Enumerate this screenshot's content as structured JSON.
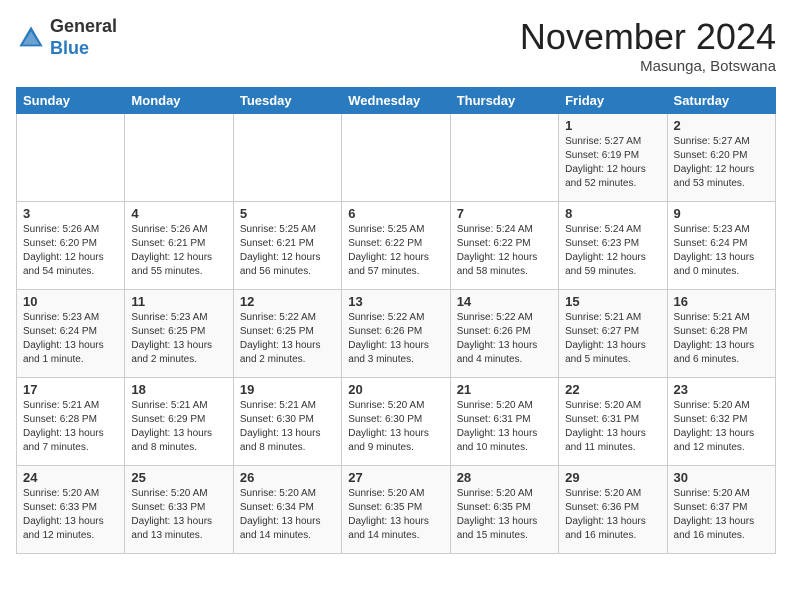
{
  "header": {
    "logo_line1": "General",
    "logo_line2": "Blue",
    "month": "November 2024",
    "location": "Masunga, Botswana"
  },
  "days_of_week": [
    "Sunday",
    "Monday",
    "Tuesday",
    "Wednesday",
    "Thursday",
    "Friday",
    "Saturday"
  ],
  "weeks": [
    [
      {
        "day": "",
        "info": ""
      },
      {
        "day": "",
        "info": ""
      },
      {
        "day": "",
        "info": ""
      },
      {
        "day": "",
        "info": ""
      },
      {
        "day": "",
        "info": ""
      },
      {
        "day": "1",
        "info": "Sunrise: 5:27 AM\nSunset: 6:19 PM\nDaylight: 12 hours\nand 52 minutes."
      },
      {
        "day": "2",
        "info": "Sunrise: 5:27 AM\nSunset: 6:20 PM\nDaylight: 12 hours\nand 53 minutes."
      }
    ],
    [
      {
        "day": "3",
        "info": "Sunrise: 5:26 AM\nSunset: 6:20 PM\nDaylight: 12 hours\nand 54 minutes."
      },
      {
        "day": "4",
        "info": "Sunrise: 5:26 AM\nSunset: 6:21 PM\nDaylight: 12 hours\nand 55 minutes."
      },
      {
        "day": "5",
        "info": "Sunrise: 5:25 AM\nSunset: 6:21 PM\nDaylight: 12 hours\nand 56 minutes."
      },
      {
        "day": "6",
        "info": "Sunrise: 5:25 AM\nSunset: 6:22 PM\nDaylight: 12 hours\nand 57 minutes."
      },
      {
        "day": "7",
        "info": "Sunrise: 5:24 AM\nSunset: 6:22 PM\nDaylight: 12 hours\nand 58 minutes."
      },
      {
        "day": "8",
        "info": "Sunrise: 5:24 AM\nSunset: 6:23 PM\nDaylight: 12 hours\nand 59 minutes."
      },
      {
        "day": "9",
        "info": "Sunrise: 5:23 AM\nSunset: 6:24 PM\nDaylight: 13 hours\nand 0 minutes."
      }
    ],
    [
      {
        "day": "10",
        "info": "Sunrise: 5:23 AM\nSunset: 6:24 PM\nDaylight: 13 hours\nand 1 minute."
      },
      {
        "day": "11",
        "info": "Sunrise: 5:23 AM\nSunset: 6:25 PM\nDaylight: 13 hours\nand 2 minutes."
      },
      {
        "day": "12",
        "info": "Sunrise: 5:22 AM\nSunset: 6:25 PM\nDaylight: 13 hours\nand 2 minutes."
      },
      {
        "day": "13",
        "info": "Sunrise: 5:22 AM\nSunset: 6:26 PM\nDaylight: 13 hours\nand 3 minutes."
      },
      {
        "day": "14",
        "info": "Sunrise: 5:22 AM\nSunset: 6:26 PM\nDaylight: 13 hours\nand 4 minutes."
      },
      {
        "day": "15",
        "info": "Sunrise: 5:21 AM\nSunset: 6:27 PM\nDaylight: 13 hours\nand 5 minutes."
      },
      {
        "day": "16",
        "info": "Sunrise: 5:21 AM\nSunset: 6:28 PM\nDaylight: 13 hours\nand 6 minutes."
      }
    ],
    [
      {
        "day": "17",
        "info": "Sunrise: 5:21 AM\nSunset: 6:28 PM\nDaylight: 13 hours\nand 7 minutes."
      },
      {
        "day": "18",
        "info": "Sunrise: 5:21 AM\nSunset: 6:29 PM\nDaylight: 13 hours\nand 8 minutes."
      },
      {
        "day": "19",
        "info": "Sunrise: 5:21 AM\nSunset: 6:30 PM\nDaylight: 13 hours\nand 8 minutes."
      },
      {
        "day": "20",
        "info": "Sunrise: 5:20 AM\nSunset: 6:30 PM\nDaylight: 13 hours\nand 9 minutes."
      },
      {
        "day": "21",
        "info": "Sunrise: 5:20 AM\nSunset: 6:31 PM\nDaylight: 13 hours\nand 10 minutes."
      },
      {
        "day": "22",
        "info": "Sunrise: 5:20 AM\nSunset: 6:31 PM\nDaylight: 13 hours\nand 11 minutes."
      },
      {
        "day": "23",
        "info": "Sunrise: 5:20 AM\nSunset: 6:32 PM\nDaylight: 13 hours\nand 12 minutes."
      }
    ],
    [
      {
        "day": "24",
        "info": "Sunrise: 5:20 AM\nSunset: 6:33 PM\nDaylight: 13 hours\nand 12 minutes."
      },
      {
        "day": "25",
        "info": "Sunrise: 5:20 AM\nSunset: 6:33 PM\nDaylight: 13 hours\nand 13 minutes."
      },
      {
        "day": "26",
        "info": "Sunrise: 5:20 AM\nSunset: 6:34 PM\nDaylight: 13 hours\nand 14 minutes."
      },
      {
        "day": "27",
        "info": "Sunrise: 5:20 AM\nSunset: 6:35 PM\nDaylight: 13 hours\nand 14 minutes."
      },
      {
        "day": "28",
        "info": "Sunrise: 5:20 AM\nSunset: 6:35 PM\nDaylight: 13 hours\nand 15 minutes."
      },
      {
        "day": "29",
        "info": "Sunrise: 5:20 AM\nSunset: 6:36 PM\nDaylight: 13 hours\nand 16 minutes."
      },
      {
        "day": "30",
        "info": "Sunrise: 5:20 AM\nSunset: 6:37 PM\nDaylight: 13 hours\nand 16 minutes."
      }
    ]
  ]
}
